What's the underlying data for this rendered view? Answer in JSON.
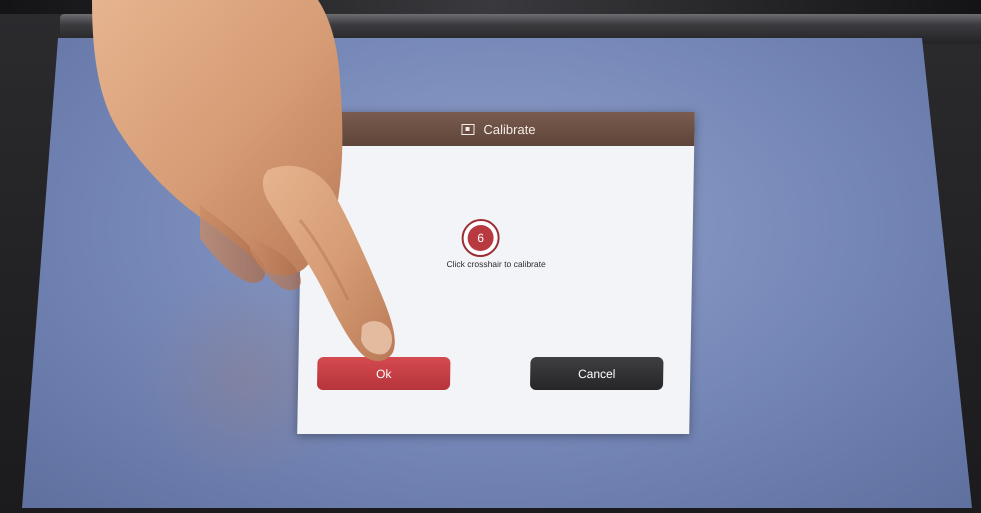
{
  "dialog": {
    "title": "Calibrate",
    "title_icon": "calibrate-icon",
    "crosshair_number": "6",
    "instruction": "Click crosshair to calibrate",
    "ok_label": "Ok",
    "cancel_label": "Cancel"
  },
  "colors": {
    "titlebar": "#6b4f43",
    "ok_button": "#c43f45",
    "cancel_button": "#2f2f31",
    "crosshair": "#b83a40",
    "screen_background": "#7a8bbb"
  }
}
